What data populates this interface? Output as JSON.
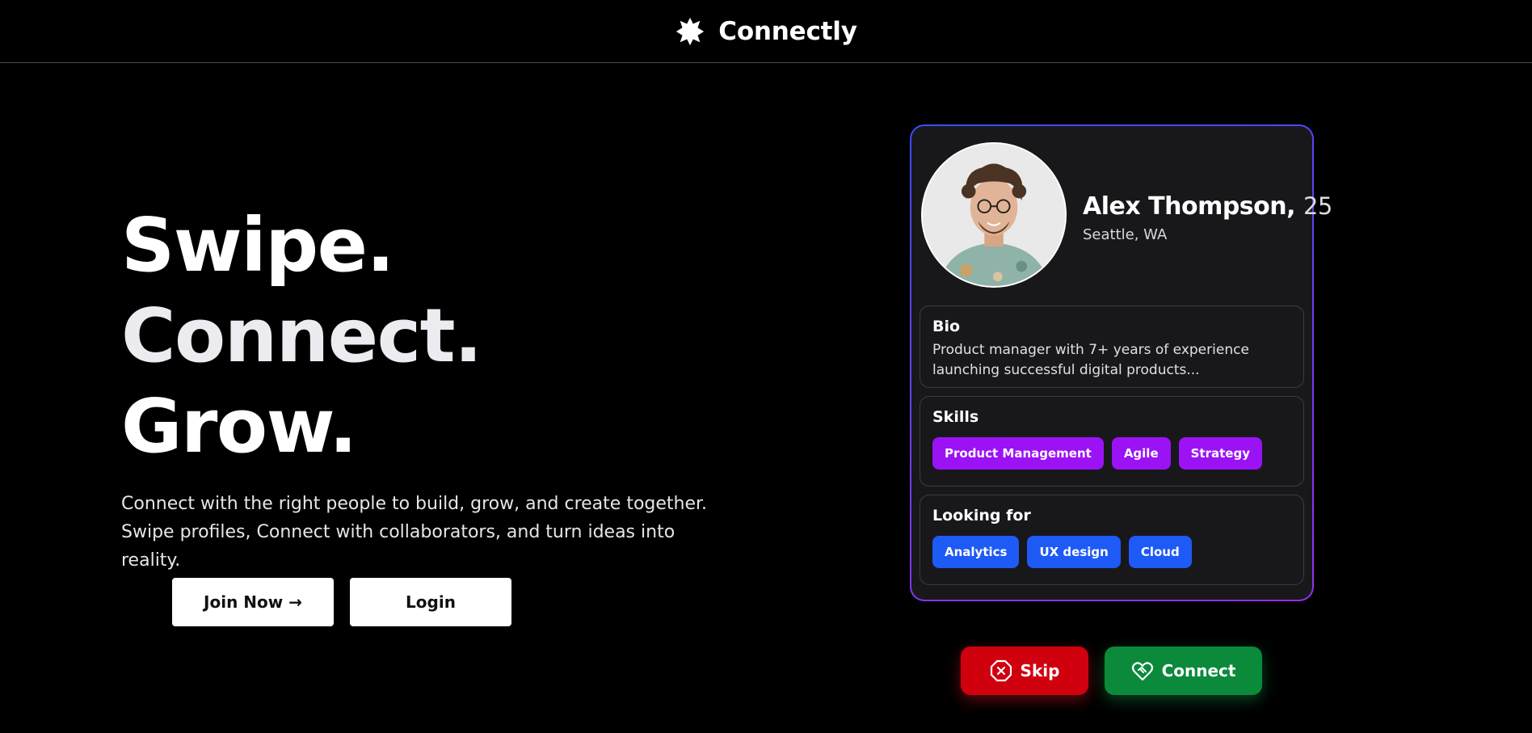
{
  "header": {
    "brand_name": "Connectly",
    "logo_icon": "puzzle-star-logo"
  },
  "hero": {
    "headline": [
      "Swipe.",
      "Connect.",
      "Grow."
    ],
    "description": "Connect with the right people to build, grow, and create together. Swipe profiles, Connect with collaborators, and turn ideas into reality.",
    "join_label": "Join Now →",
    "login_label": "Login"
  },
  "profile": {
    "name": "Alex Thompson,",
    "age": "25",
    "location": "Seattle, WA",
    "bio_title": "Bio",
    "bio_text": "Product manager with 7+ years of experience launching successful digital products...",
    "skills_title": "Skills",
    "skills": [
      "Product Management",
      "Agile",
      "Strategy"
    ],
    "looking_title": "Looking for",
    "looking_for": [
      "Analytics",
      "UX design",
      "Cloud"
    ]
  },
  "actions": {
    "skip_label": "Skip",
    "connect_label": "Connect"
  },
  "colors": {
    "skip": "#d0000f",
    "connect": "#0a8a3a",
    "skill_chip": "#9b12f5",
    "looking_chip": "#1e5af5",
    "card_border_start": "#3b4dff",
    "card_border_end": "#9a2cf0"
  }
}
